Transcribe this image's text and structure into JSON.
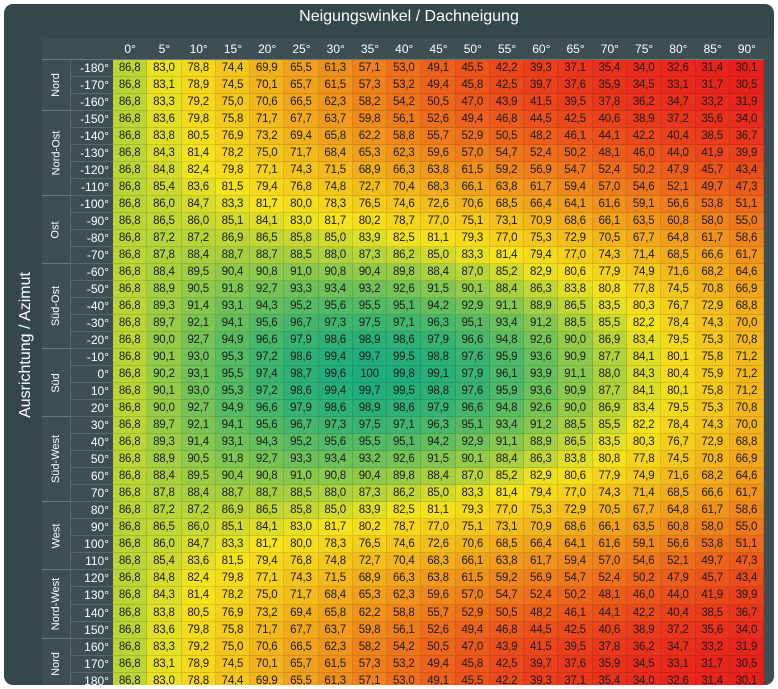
{
  "titles": {
    "top": "Neigungswinkel / Dachneigung",
    "left": "Ausrichtung / Azimut"
  },
  "chart_data": {
    "type": "heatmap",
    "x_label": "Neigungswinkel / Dachneigung",
    "y_label": "Ausrichtung / Azimut",
    "columns": [
      "0°",
      "5°",
      "10°",
      "15°",
      "20°",
      "25°",
      "30°",
      "35°",
      "40°",
      "45°",
      "50°",
      "55°",
      "60°",
      "65°",
      "70°",
      "75°",
      "80°",
      "85°",
      "90°"
    ],
    "direction_groups": [
      {
        "label": "Nord",
        "rows": 3
      },
      {
        "label": "Nord-Ost",
        "rows": 5
      },
      {
        "label": "Ost",
        "rows": 4
      },
      {
        "label": "Süd-Ost",
        "rows": 5
      },
      {
        "label": "Süd",
        "rows": 4
      },
      {
        "label": "Süd-West",
        "rows": 5
      },
      {
        "label": "West",
        "rows": 4
      },
      {
        "label": "Nord-West",
        "rows": 4
      },
      {
        "label": "Nord",
        "rows": 3
      }
    ],
    "color_scale": {
      "low": "#e8201c",
      "mid": "#f6e41c",
      "high": "#1dac7e"
    },
    "rows": [
      {
        "label": "-180°",
        "values": [
          "86,8",
          "83,0",
          "78,8",
          "74,4",
          "69,9",
          "65,5",
          "61,3",
          "57,1",
          "53,0",
          "49,1",
          "45,5",
          "42,2",
          "39,3",
          "37,1",
          "35,4",
          "34,0",
          "32,6",
          "31,4",
          "30,1"
        ]
      },
      {
        "label": "-170°",
        "values": [
          "86,8",
          "83,1",
          "78,9",
          "74,5",
          "70,1",
          "65,7",
          "61,5",
          "57,3",
          "53,2",
          "49,4",
          "45,8",
          "42,5",
          "39,7",
          "37,6",
          "35,9",
          "34,5",
          "33,1",
          "31,7",
          "30,5"
        ]
      },
      {
        "label": "-160°",
        "values": [
          "86,8",
          "83,3",
          "79,2",
          "75,0",
          "70,6",
          "66,5",
          "62,3",
          "58,2",
          "54,2",
          "50,5",
          "47,0",
          "43,9",
          "41,5",
          "39,5",
          "37,8",
          "36,2",
          "34,7",
          "33,2",
          "31,9"
        ]
      },
      {
        "label": "-150°",
        "values": [
          "86,8",
          "83,6",
          "79,8",
          "75,8",
          "71,7",
          "67,7",
          "63,7",
          "59,8",
          "56,1",
          "52,6",
          "49,4",
          "46,8",
          "44,5",
          "42,5",
          "40,6",
          "38,9",
          "37,2",
          "35,6",
          "34,0"
        ]
      },
      {
        "label": "-140°",
        "values": [
          "86,8",
          "83,8",
          "80,5",
          "76,9",
          "73,2",
          "69,4",
          "65,8",
          "62,2",
          "58,8",
          "55,7",
          "52,9",
          "50,5",
          "48,2",
          "46,1",
          "44,1",
          "42,2",
          "40,4",
          "38,5",
          "36,7"
        ]
      },
      {
        "label": "-130°",
        "values": [
          "86,8",
          "84,3",
          "81,4",
          "78,2",
          "75,0",
          "71,7",
          "68,4",
          "65,3",
          "62,3",
          "59,6",
          "57,0",
          "54,7",
          "52,4",
          "50,2",
          "48,1",
          "46,0",
          "44,0",
          "41,9",
          "39,9"
        ]
      },
      {
        "label": "-120°",
        "values": [
          "86,8",
          "84,8",
          "82,4",
          "79,8",
          "77,1",
          "74,3",
          "71,5",
          "68,9",
          "66,3",
          "63,8",
          "61,5",
          "59,2",
          "56,9",
          "54,7",
          "52,4",
          "50,2",
          "47,9",
          "45,7",
          "43,4"
        ]
      },
      {
        "label": "-110°",
        "values": [
          "86,8",
          "85,4",
          "83,6",
          "81,5",
          "79,4",
          "76,8",
          "74,8",
          "72,7",
          "70,4",
          "68,3",
          "66,1",
          "63,8",
          "61,7",
          "59,4",
          "57,0",
          "54,6",
          "52,1",
          "49,7",
          "47,3"
        ]
      },
      {
        "label": "-100°",
        "values": [
          "86,8",
          "86,0",
          "84,7",
          "83,3",
          "81,7",
          "80,0",
          "78,3",
          "76,5",
          "74,6",
          "72,6",
          "70,6",
          "68,5",
          "66,4",
          "64,1",
          "61,6",
          "59,1",
          "56,6",
          "53,8",
          "51,1"
        ]
      },
      {
        "label": "-90°",
        "values": [
          "86,8",
          "86,5",
          "86,0",
          "85,1",
          "84,1",
          "83,0",
          "81,7",
          "80,2",
          "78,7",
          "77,0",
          "75,1",
          "73,1",
          "70,9",
          "68,6",
          "66,1",
          "63,5",
          "60,8",
          "58,0",
          "55,0"
        ]
      },
      {
        "label": "-80°",
        "values": [
          "86,8",
          "87,2",
          "87,2",
          "86,9",
          "86,5",
          "85,8",
          "85,0",
          "83,9",
          "82,5",
          "81,1",
          "79,3",
          "77,0",
          "75,3",
          "72,9",
          "70,5",
          "67,7",
          "64,8",
          "61,7",
          "58,6"
        ]
      },
      {
        "label": "-70°",
        "values": [
          "86,8",
          "87,8",
          "88,4",
          "88,7",
          "88,7",
          "88,5",
          "88,0",
          "87,3",
          "86,2",
          "85,0",
          "83,3",
          "81,4",
          "79,4",
          "77,0",
          "74,3",
          "71,4",
          "68,5",
          "66,6",
          "61,7"
        ]
      },
      {
        "label": "-60°",
        "values": [
          "86,8",
          "88,4",
          "89,5",
          "90,4",
          "90,8",
          "91,0",
          "90,8",
          "90,4",
          "89,8",
          "88,4",
          "87,0",
          "85,2",
          "82,9",
          "80,6",
          "77,9",
          "74,9",
          "71,6",
          "68,2",
          "64,6"
        ]
      },
      {
        "label": "-50°",
        "values": [
          "86,8",
          "88,9",
          "90,5",
          "91,8",
          "92,7",
          "93,3",
          "93,4",
          "93,2",
          "92,6",
          "91,5",
          "90,1",
          "88,4",
          "86,3",
          "83,8",
          "80,8",
          "77,8",
          "74,5",
          "70,8",
          "66,9"
        ]
      },
      {
        "label": "-40°",
        "values": [
          "86,8",
          "89,3",
          "91,4",
          "93,1",
          "94,3",
          "95,2",
          "95,6",
          "95,5",
          "95,1",
          "94,2",
          "92,9",
          "91,1",
          "88,9",
          "86,5",
          "83,5",
          "80,3",
          "76,7",
          "72,9",
          "68,8"
        ]
      },
      {
        "label": "-30°",
        "values": [
          "86,8",
          "89,7",
          "92,1",
          "94,1",
          "95,6",
          "96,7",
          "97,3",
          "97,5",
          "97,1",
          "96,3",
          "95,1",
          "93,4",
          "91,2",
          "88,5",
          "85,5",
          "82,2",
          "78,4",
          "74,3",
          "70,0"
        ]
      },
      {
        "label": "-20°",
        "values": [
          "86,8",
          "90,0",
          "92,7",
          "94,9",
          "96,6",
          "97,9",
          "98,6",
          "98,9",
          "98,6",
          "97,9",
          "96,6",
          "94,8",
          "92,6",
          "90,0",
          "86,9",
          "83,4",
          "79,5",
          "75,3",
          "70,8"
        ]
      },
      {
        "label": "-10°",
        "values": [
          "86,8",
          "90,1",
          "93,0",
          "95,3",
          "97,2",
          "98,6",
          "99,4",
          "99,7",
          "99,5",
          "98,8",
          "97,6",
          "95,9",
          "93,6",
          "90,9",
          "87,7",
          "84,1",
          "80,1",
          "75,8",
          "71,2"
        ]
      },
      {
        "label": "0°",
        "values": [
          "86,8",
          "90,2",
          "93,1",
          "95,5",
          "97,4",
          "98,7",
          "99,6",
          "100",
          "99,8",
          "99,1",
          "97,9",
          "96,1",
          "93,9",
          "91,1",
          "88,0",
          "84,3",
          "80,4",
          "75,9",
          "71,2"
        ]
      },
      {
        "label": "10°",
        "values": [
          "86,8",
          "90,1",
          "93,0",
          "95,3",
          "97,2",
          "98,6",
          "99,4",
          "99,7",
          "99,5",
          "98,8",
          "97,6",
          "95,9",
          "93,6",
          "90,9",
          "87,7",
          "84,1",
          "80,1",
          "75,8",
          "71,2"
        ]
      },
      {
        "label": "20°",
        "values": [
          "86,8",
          "90,0",
          "92,7",
          "94,9",
          "96,6",
          "97,9",
          "98,6",
          "98,9",
          "98,6",
          "97,9",
          "96,6",
          "94,8",
          "92,6",
          "90,0",
          "86,9",
          "83,4",
          "79,5",
          "75,3",
          "70,8"
        ]
      },
      {
        "label": "30°",
        "values": [
          "86,8",
          "89,7",
          "92,1",
          "94,1",
          "95,6",
          "96,7",
          "97,3",
          "97,5",
          "97,1",
          "96,3",
          "95,1",
          "93,4",
          "91,2",
          "88,5",
          "85,5",
          "82,2",
          "78,4",
          "74,3",
          "70,0"
        ]
      },
      {
        "label": "40°",
        "values": [
          "86,8",
          "89,3",
          "91,4",
          "93,1",
          "94,3",
          "95,2",
          "95,6",
          "95,5",
          "95,1",
          "94,2",
          "92,9",
          "91,1",
          "88,9",
          "86,5",
          "83,5",
          "80,3",
          "76,7",
          "72,9",
          "68,8"
        ]
      },
      {
        "label": "50°",
        "values": [
          "86,8",
          "88,9",
          "90,5",
          "91,8",
          "92,7",
          "93,3",
          "93,4",
          "93,2",
          "92,6",
          "91,5",
          "90,1",
          "88,4",
          "86,3",
          "83,8",
          "80,8",
          "77,8",
          "74,5",
          "70,8",
          "66,9"
        ]
      },
      {
        "label": "60°",
        "values": [
          "86,8",
          "88,4",
          "89,5",
          "90,4",
          "90,8",
          "91,0",
          "90,8",
          "90,4",
          "89,8",
          "88,4",
          "87,0",
          "85,2",
          "82,9",
          "80,6",
          "77,9",
          "74,9",
          "71,6",
          "68,2",
          "64,6"
        ]
      },
      {
        "label": "70°",
        "values": [
          "86,8",
          "87,8",
          "88,4",
          "88,7",
          "88,7",
          "88,5",
          "88,0",
          "87,3",
          "86,2",
          "85,0",
          "83,3",
          "81,4",
          "79,4",
          "77,0",
          "74,3",
          "71,4",
          "68,5",
          "66,6",
          "61,7"
        ]
      },
      {
        "label": "80°",
        "values": [
          "86,8",
          "87,2",
          "87,2",
          "86,9",
          "86,5",
          "85,8",
          "85,0",
          "83,9",
          "82,5",
          "81,1",
          "79,3",
          "77,0",
          "75,3",
          "72,9",
          "70,5",
          "67,7",
          "64,8",
          "61,7",
          "58,6"
        ]
      },
      {
        "label": "90°",
        "values": [
          "86,8",
          "86,5",
          "86,0",
          "85,1",
          "84,1",
          "83,0",
          "81,7",
          "80,2",
          "78,7",
          "77,0",
          "75,1",
          "73,1",
          "70,9",
          "68,6",
          "66,1",
          "63,5",
          "60,8",
          "58,0",
          "55,0"
        ]
      },
      {
        "label": "100°",
        "values": [
          "86,8",
          "86,0",
          "84,7",
          "83,3",
          "81,7",
          "80,0",
          "78,3",
          "76,5",
          "74,6",
          "72,6",
          "70,6",
          "68,5",
          "66,4",
          "64,1",
          "61,6",
          "59,1",
          "56,6",
          "53,8",
          "51,1"
        ]
      },
      {
        "label": "110°",
        "values": [
          "86,8",
          "85,4",
          "83,6",
          "81,5",
          "79,4",
          "76,8",
          "74,8",
          "72,7",
          "70,4",
          "68,3",
          "66,1",
          "63,8",
          "61,7",
          "59,4",
          "57,0",
          "54,6",
          "52,1",
          "49,7",
          "47,3"
        ]
      },
      {
        "label": "120°",
        "values": [
          "86,8",
          "84,8",
          "82,4",
          "79,8",
          "77,1",
          "74,3",
          "71,5",
          "68,9",
          "66,3",
          "63,8",
          "61,5",
          "59,2",
          "56,9",
          "54,7",
          "52,4",
          "50,2",
          "47,9",
          "45,7",
          "43,4"
        ]
      },
      {
        "label": "130°",
        "values": [
          "86,8",
          "84,3",
          "81,4",
          "78,2",
          "75,0",
          "71,7",
          "68,4",
          "65,3",
          "62,3",
          "59,6",
          "57,0",
          "54,7",
          "52,4",
          "50,2",
          "48,1",
          "46,0",
          "44,0",
          "41,9",
          "39,9"
        ]
      },
      {
        "label": "140°",
        "values": [
          "86,8",
          "83,8",
          "80,5",
          "76,9",
          "73,2",
          "69,4",
          "65,8",
          "62,2",
          "58,8",
          "55,7",
          "52,9",
          "50,5",
          "48,2",
          "46,1",
          "44,1",
          "42,2",
          "40,4",
          "38,5",
          "36,7"
        ]
      },
      {
        "label": "150°",
        "values": [
          "86,8",
          "83,6",
          "79,8",
          "75,8",
          "71,7",
          "67,7",
          "63,7",
          "59,8",
          "56,1",
          "52,6",
          "49,4",
          "46,8",
          "44,5",
          "42,5",
          "40,6",
          "38,9",
          "37,2",
          "35,6",
          "34,0"
        ]
      },
      {
        "label": "160°",
        "values": [
          "86,8",
          "83,3",
          "79,2",
          "75,0",
          "70,6",
          "66,5",
          "62,3",
          "58,2",
          "54,2",
          "50,5",
          "47,0",
          "43,9",
          "41,5",
          "39,5",
          "37,8",
          "36,2",
          "34,7",
          "33,2",
          "31,9"
        ]
      },
      {
        "label": "170°",
        "values": [
          "86,8",
          "83,1",
          "78,9",
          "74,5",
          "70,1",
          "65,7",
          "61,5",
          "57,3",
          "53,2",
          "49,4",
          "45,8",
          "42,5",
          "39,7",
          "37,6",
          "35,9",
          "34,5",
          "33,1",
          "31,7",
          "30,5"
        ]
      },
      {
        "label": "180°",
        "values": [
          "86,8",
          "83,0",
          "78,8",
          "74,4",
          "69,9",
          "65,5",
          "61,3",
          "57,1",
          "53,0",
          "49,1",
          "45,5",
          "42,2",
          "39,3",
          "37,1",
          "35,4",
          "34,0",
          "32,6",
          "31,4",
          "30,1"
        ]
      }
    ]
  }
}
